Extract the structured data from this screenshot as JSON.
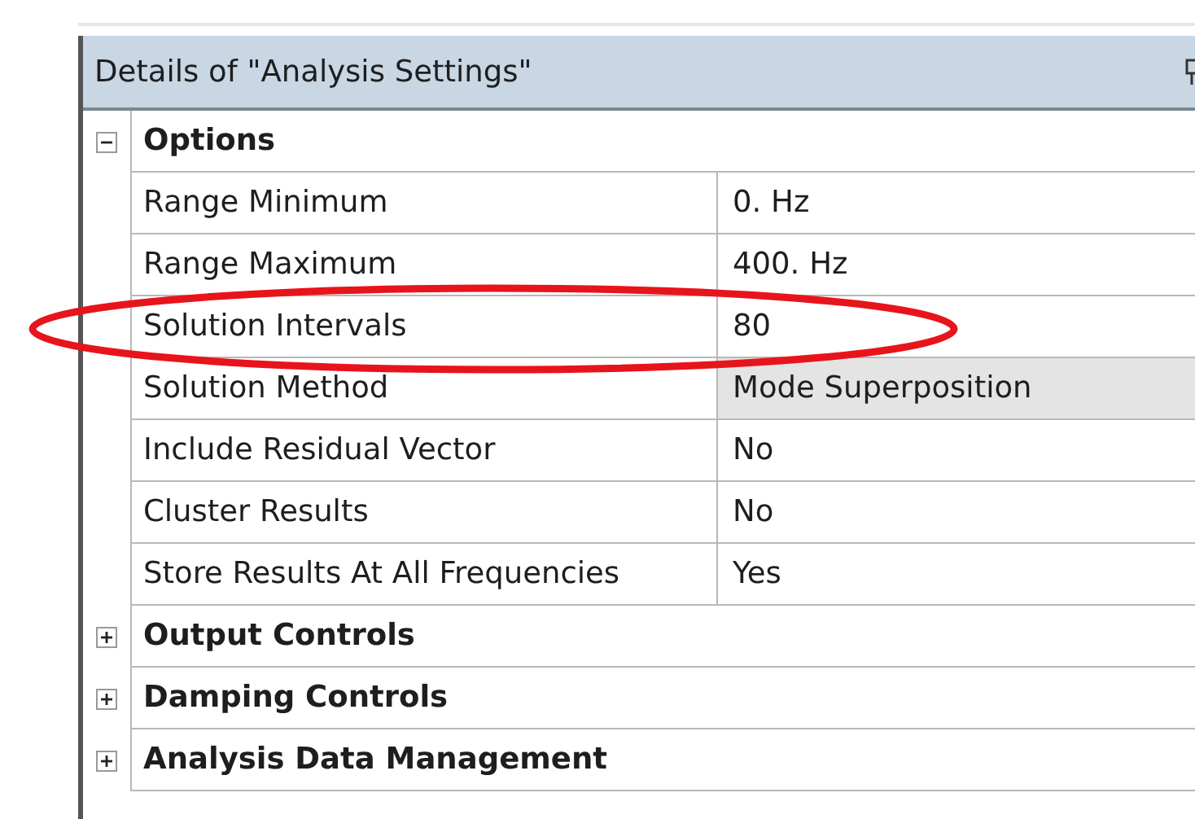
{
  "panel": {
    "title": "Details of \"Analysis Settings\""
  },
  "groups": [
    {
      "label": "Options",
      "expanded": true,
      "properties": [
        {
          "label": "Range Minimum",
          "value": "0. Hz",
          "kind": "text"
        },
        {
          "label": "Range Maximum",
          "value": "400. Hz",
          "kind": "text"
        },
        {
          "label": "Solution Intervals",
          "value": "80",
          "kind": "text"
        },
        {
          "label": "Solution Method",
          "value": "Mode Superposition",
          "kind": "readonly"
        },
        {
          "label": "Include Residual Vector",
          "value": "No",
          "kind": "text"
        },
        {
          "label": "Cluster Results",
          "value": "No",
          "kind": "text"
        },
        {
          "label": "Store Results At All Frequencies",
          "value": "Yes",
          "kind": "text"
        }
      ]
    },
    {
      "label": "Output Controls",
      "expanded": false
    },
    {
      "label": "Damping Controls",
      "expanded": false
    },
    {
      "label": "Analysis Data Management",
      "expanded": false
    }
  ],
  "annotations": [
    {
      "kind": "ellipse",
      "color": "#e8141c"
    }
  ]
}
